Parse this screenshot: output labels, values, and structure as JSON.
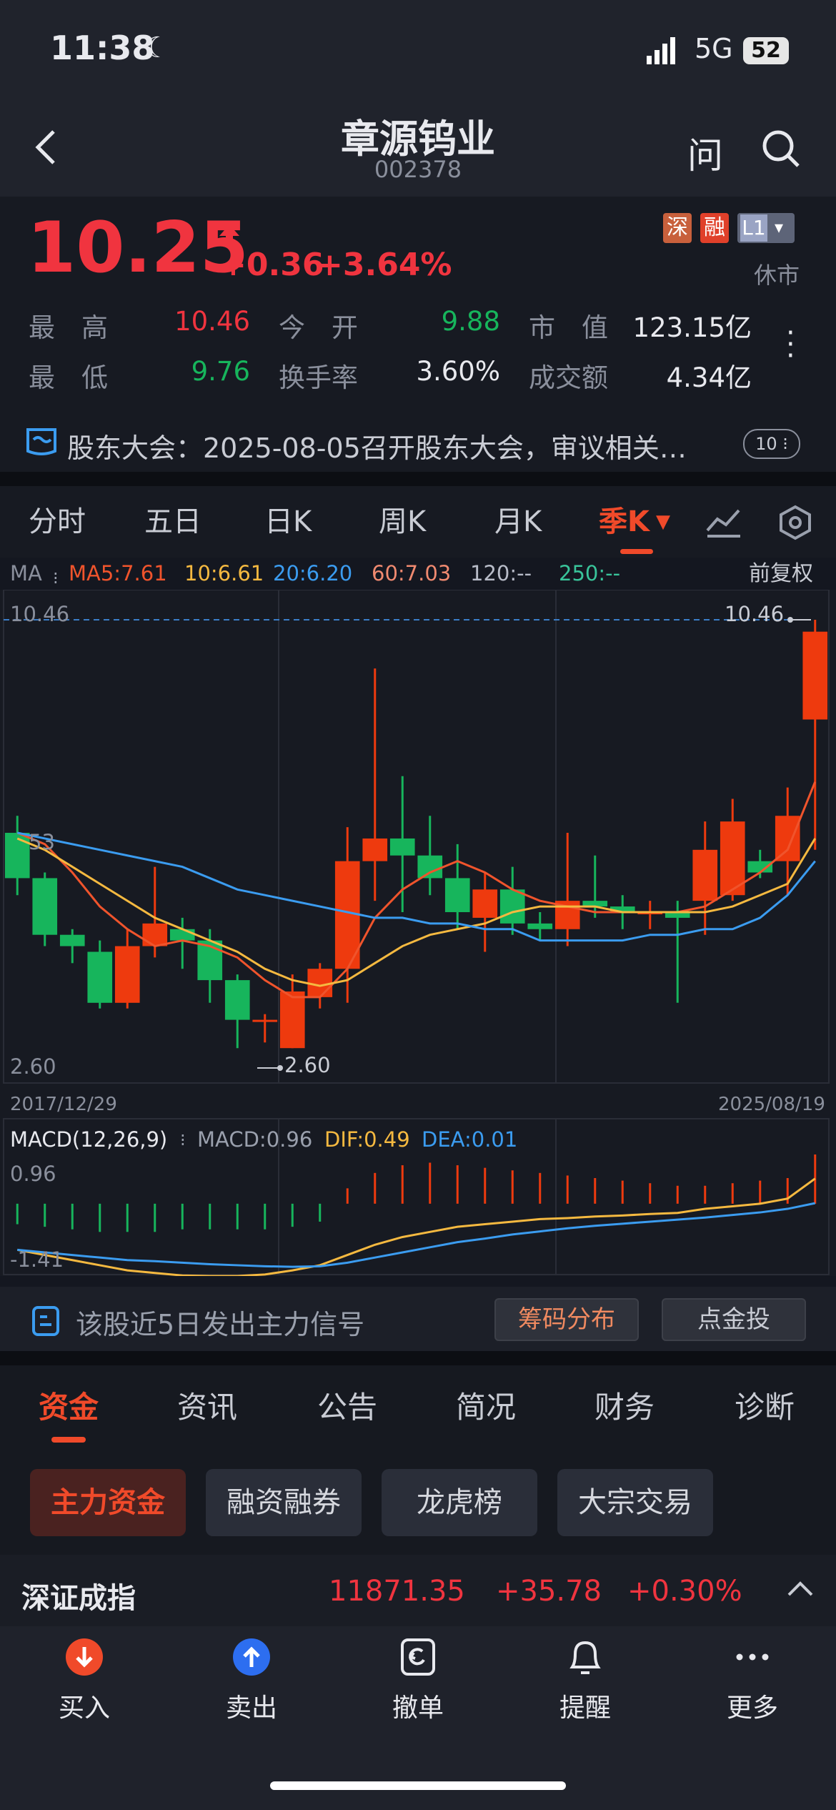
{
  "status_bar": {
    "time": "11:38",
    "network": "5G",
    "battery": "52"
  },
  "header": {
    "title": "章源钨业",
    "code": "002378",
    "ask_label": "问"
  },
  "quote": {
    "price": "10.25",
    "change": "+0.36",
    "change_pct": "+3.64%",
    "badges": [
      "深",
      "融",
      "L1"
    ],
    "market_status": "休市",
    "stats": [
      {
        "label": "最　高",
        "value": "10.46",
        "color": "#f0343f"
      },
      {
        "label": "今　开",
        "value": "9.88",
        "color": "#17b55c"
      },
      {
        "label": "市　值",
        "value": "123.15亿",
        "color": "#e8e9ee"
      },
      {
        "label": "最　低",
        "value": "9.76",
        "color": "#17b55c"
      },
      {
        "label": "换手率",
        "value": "3.60%",
        "color": "#e8e9ee"
      },
      {
        "label": "成交额",
        "value": "4.34亿",
        "color": "#e8e9ee"
      }
    ],
    "notice": "股东大会：2025-08-05召开股东大会，审议相关…",
    "notice_count": "10"
  },
  "chart_tabs": [
    "分时",
    "五日",
    "日K",
    "周K",
    "月K",
    "季K"
  ],
  "active_tab": "季K",
  "ma_legend": {
    "label": "MA",
    "items": [
      {
        "text": "MA5:7.61",
        "color": "#f0542c"
      },
      {
        "text": "10:6.61",
        "color": "#f5b940"
      },
      {
        "text": "20:6.20",
        "color": "#3b9cf0"
      },
      {
        "text": "60:7.03",
        "color": "#f08a70"
      },
      {
        "text": "120:--",
        "color": "#b8bcc8"
      },
      {
        "text": "250:--",
        "color": "#39c49a"
      }
    ],
    "adjust": "前复权"
  },
  "chart_data": {
    "type": "candlestick",
    "y_max_label": "10.46",
    "y_min_label": "2.60",
    "y_mid_label": "53",
    "high_marker": "10.46",
    "low_marker": "2.60",
    "start_date": "2017/12/29",
    "end_date": "2025/08/19",
    "ylim": [
      2.6,
      10.46
    ],
    "candles": [
      {
        "o": 6.7,
        "c": 5.9,
        "h": 7.0,
        "l": 5.6
      },
      {
        "o": 5.9,
        "c": 4.9,
        "h": 6.0,
        "l": 4.7
      },
      {
        "o": 4.9,
        "c": 4.7,
        "h": 5.0,
        "l": 4.4
      },
      {
        "o": 4.6,
        "c": 3.7,
        "h": 4.8,
        "l": 3.6
      },
      {
        "o": 3.7,
        "c": 4.7,
        "h": 5.0,
        "l": 3.6
      },
      {
        "o": 4.7,
        "c": 5.1,
        "h": 6.1,
        "l": 4.5
      },
      {
        "o": 5.0,
        "c": 4.8,
        "h": 5.2,
        "l": 4.3
      },
      {
        "o": 4.8,
        "c": 4.1,
        "h": 5.0,
        "l": 3.7
      },
      {
        "o": 4.1,
        "c": 3.4,
        "h": 4.2,
        "l": 2.9
      },
      {
        "o": 3.4,
        "c": 3.4,
        "h": 3.5,
        "l": 3.0
      },
      {
        "o": 2.9,
        "c": 3.9,
        "h": 4.2,
        "l": 2.9
      },
      {
        "o": 3.8,
        "c": 4.3,
        "h": 4.4,
        "l": 3.6
      },
      {
        "o": 4.3,
        "c": 6.2,
        "h": 6.8,
        "l": 3.7
      },
      {
        "o": 6.2,
        "c": 6.6,
        "h": 9.6,
        "l": 5.5
      },
      {
        "o": 6.6,
        "c": 6.3,
        "h": 7.7,
        "l": 5.3
      },
      {
        "o": 6.3,
        "c": 5.9,
        "h": 7.0,
        "l": 5.6
      },
      {
        "o": 5.9,
        "c": 5.3,
        "h": 6.5,
        "l": 5.0
      },
      {
        "o": 5.2,
        "c": 5.7,
        "h": 6.0,
        "l": 4.6
      },
      {
        "o": 5.7,
        "c": 5.1,
        "h": 6.1,
        "l": 4.9
      },
      {
        "o": 5.1,
        "c": 5.0,
        "h": 5.3,
        "l": 4.8
      },
      {
        "o": 5.0,
        "c": 5.5,
        "h": 6.7,
        "l": 4.7
      },
      {
        "o": 5.5,
        "c": 5.4,
        "h": 6.3,
        "l": 5.2
      },
      {
        "o": 5.4,
        "c": 5.3,
        "h": 5.6,
        "l": 5.0
      },
      {
        "o": 5.3,
        "c": 5.3,
        "h": 5.5,
        "l": 5.0
      },
      {
        "o": 5.3,
        "c": 5.2,
        "h": 5.5,
        "l": 3.7
      },
      {
        "o": 5.5,
        "c": 6.4,
        "h": 6.9,
        "l": 4.9
      },
      {
        "o": 5.6,
        "c": 6.9,
        "h": 7.3,
        "l": 5.5
      },
      {
        "o": 6.2,
        "c": 6.0,
        "h": 6.4,
        "l": 5.9
      },
      {
        "o": 6.2,
        "c": 7.0,
        "h": 7.5,
        "l": 5.6
      },
      {
        "o": 8.7,
        "c": 10.25,
        "h": 10.46,
        "l": 6.4
      }
    ],
    "ma_lines": [
      {
        "name": "MA5",
        "color": "#f0542c",
        "values": [
          6.7,
          6.5,
          6.0,
          5.4,
          5.0,
          4.7,
          4.8,
          4.7,
          4.5,
          4.1,
          3.8,
          3.8,
          4.3,
          5.2,
          5.7,
          6.0,
          6.2,
          6.0,
          5.7,
          5.5,
          5.4,
          5.3,
          5.3,
          5.3,
          5.3,
          5.4,
          5.7,
          6.0,
          6.4,
          7.6
        ]
      },
      {
        "name": "10",
        "color": "#f5b940",
        "values": [
          6.6,
          6.4,
          6.1,
          5.8,
          5.5,
          5.2,
          5.0,
          4.8,
          4.6,
          4.3,
          4.1,
          4.0,
          4.1,
          4.4,
          4.7,
          4.9,
          5.0,
          5.1,
          5.3,
          5.4,
          5.4,
          5.4,
          5.3,
          5.3,
          5.3,
          5.3,
          5.4,
          5.6,
          5.8,
          6.6
        ]
      },
      {
        "name": "20",
        "color": "#3b9cf0",
        "values": [
          6.7,
          6.6,
          6.5,
          6.4,
          6.3,
          6.2,
          6.1,
          5.9,
          5.7,
          5.6,
          5.5,
          5.4,
          5.3,
          5.2,
          5.2,
          5.1,
          5.1,
          5.0,
          5.0,
          4.8,
          4.8,
          4.8,
          4.8,
          4.9,
          4.9,
          5.0,
          5.0,
          5.2,
          5.6,
          6.2
        ]
      }
    ]
  },
  "macd": {
    "label": "MACD(12,26,9)",
    "macd_value": "MACD:0.96",
    "dif_value": "DIF:0.49",
    "dea_value": "DEA:0.01",
    "y_max_label": "0.96",
    "y_min_label": "-1.41",
    "ylim": [
      -1.41,
      0.96
    ],
    "histogram": [
      -0.4,
      -0.45,
      -0.5,
      -0.55,
      -0.55,
      -0.55,
      -0.5,
      -0.5,
      -0.5,
      -0.5,
      -0.45,
      -0.35,
      0.3,
      0.6,
      0.75,
      0.8,
      0.75,
      0.7,
      0.65,
      0.6,
      0.55,
      0.5,
      0.45,
      0.4,
      0.35,
      0.35,
      0.4,
      0.45,
      0.5,
      0.96
    ],
    "dif": [
      -0.9,
      -1.0,
      -1.1,
      -1.2,
      -1.3,
      -1.35,
      -1.4,
      -1.41,
      -1.41,
      -1.38,
      -1.3,
      -1.2,
      -1.0,
      -0.8,
      -0.65,
      -0.55,
      -0.45,
      -0.4,
      -0.35,
      -0.3,
      -0.28,
      -0.25,
      -0.23,
      -0.2,
      -0.18,
      -0.1,
      -0.05,
      0.0,
      0.1,
      0.49
    ],
    "dea": [
      -0.9,
      -0.95,
      -1.0,
      -1.05,
      -1.1,
      -1.12,
      -1.15,
      -1.18,
      -1.2,
      -1.22,
      -1.23,
      -1.22,
      -1.15,
      -1.05,
      -0.95,
      -0.85,
      -0.75,
      -0.68,
      -0.6,
      -0.54,
      -0.48,
      -0.43,
      -0.39,
      -0.35,
      -0.31,
      -0.27,
      -0.22,
      -0.17,
      -0.1,
      0.01
    ]
  },
  "signal_bar": {
    "text": "该股近5日发出主力信号",
    "btn1": "筹码分布",
    "btn2": "点金投"
  },
  "feature_tabs": [
    "资金",
    "资讯",
    "公告",
    "简况",
    "财务",
    "诊断"
  ],
  "active_feature": "资金",
  "sub_chips": [
    "主力资金",
    "融资融券",
    "龙虎榜",
    "大宗交易"
  ],
  "index_bar": {
    "name": "深证成指",
    "value": "11871.35",
    "change": "+35.78",
    "pct": "+0.30%"
  },
  "bottom_nav": [
    "买入",
    "卖出",
    "撤单",
    "提醒",
    "更多"
  ],
  "colors": {
    "up": "#f0343f",
    "up_candle": "#ee3a0e",
    "down": "#17b55c",
    "accent": "#f04a2a"
  }
}
